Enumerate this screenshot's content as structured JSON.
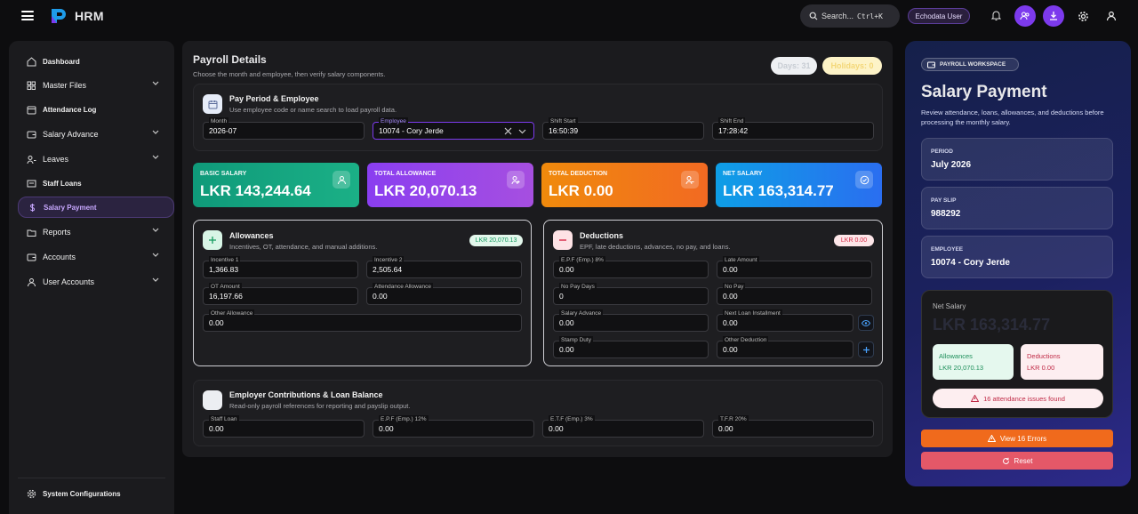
{
  "app": {
    "brand": "HRM",
    "search_label": "Search...",
    "search_shortcut": "Ctrl+K",
    "user": "Echodata User"
  },
  "sidebar": {
    "items": [
      {
        "label": "Dashboard",
        "icon": "home-icon",
        "chevron": false
      },
      {
        "label": "Master Files",
        "icon": "grid-icon",
        "chevron": true
      },
      {
        "label": "Attendance Log",
        "icon": "calendar-icon",
        "chevron": false
      },
      {
        "label": "Salary Advance",
        "icon": "wallet-icon",
        "chevron": true
      },
      {
        "label": "Leaves",
        "icon": "users-icon",
        "chevron": true
      },
      {
        "label": "Staff Loans",
        "icon": "loan-icon",
        "chevron": false
      },
      {
        "label": "Salary Payment",
        "icon": "dollar-icon",
        "chevron": false,
        "active": true
      },
      {
        "label": "Reports",
        "icon": "folder-icon",
        "chevron": true
      },
      {
        "label": "Accounts",
        "icon": "wallet-icon",
        "chevron": true
      },
      {
        "label": "User Accounts",
        "icon": "user-icon",
        "chevron": true
      }
    ],
    "footer": "System Configurations"
  },
  "page": {
    "title": "Payroll Details",
    "subtitle": "Choose the month and employee, then verify salary components.",
    "days": "Days: 31",
    "holidays": "Holidays: 0"
  },
  "period": {
    "title": "Pay Period & Employee",
    "subtitle": "Use employee code or name search to load payroll data.",
    "fields": {
      "month": {
        "label": "Month",
        "value": "2026-07"
      },
      "employee": {
        "label": "Employee",
        "value": "10074 - Cory Jerde"
      },
      "shift_start": {
        "label": "Shift Start",
        "value": "16:50:39"
      },
      "shift_end": {
        "label": "Shift End",
        "value": "17:28:42"
      }
    }
  },
  "stats": [
    {
      "label": "BASIC SALARY",
      "value": "LKR 143,244.64",
      "color": "#14a37f"
    },
    {
      "label": "TOTAL ALLOWANCE",
      "value": "LKR 20,070.13",
      "color": "#8b3fe8"
    },
    {
      "label": "TOTAL DEDUCTION",
      "value": "LKR 0.00",
      "color": "#f07d14"
    },
    {
      "label": "NET SALARY",
      "value": "LKR 163,314.77",
      "color": "#1d8ef0"
    }
  ],
  "allowances": {
    "title": "Allowances",
    "subtitle": "Incentives, OT, attendance, and manual additions.",
    "badge": "LKR 20,070.13",
    "fields": [
      {
        "label": "Incentive 1",
        "value": "1,366.83"
      },
      {
        "label": "Incentive 2",
        "value": "2,505.64"
      },
      {
        "label": "OT Amount",
        "value": "16,197.66"
      },
      {
        "label": "Attendance Allowance",
        "value": "0.00"
      },
      {
        "label": "Other Allowance",
        "value": "0.00"
      }
    ]
  },
  "deductions": {
    "title": "Deductions",
    "subtitle": "EPF, late deductions, advances, no pay, and loans.",
    "badge": "LKR 0.00",
    "fields": [
      {
        "label": "E.P.F (Emp.) 8%",
        "value": "0.00"
      },
      {
        "label": "Late Amount",
        "value": "0.00"
      },
      {
        "label": "No Pay Days",
        "value": "0"
      },
      {
        "label": "No Pay",
        "value": "0.00"
      },
      {
        "label": "Salary Advance",
        "value": "0.00"
      },
      {
        "label": "Next Loan Installment",
        "value": "0.00"
      },
      {
        "label": "Stamp Duty",
        "value": "0.00"
      },
      {
        "label": "Other Deduction",
        "value": "0.00"
      }
    ]
  },
  "employer": {
    "title": "Employer Contributions & Loan Balance",
    "subtitle": "Read-only payroll references for reporting and payslip output.",
    "fields": [
      {
        "label": "Staff Loan",
        "value": "0.00"
      },
      {
        "label": "E.P.F (Emp.) 12%",
        "value": "0.00"
      },
      {
        "label": "E.T.F (Emp.) 3%",
        "value": "0.00"
      },
      {
        "label": "T.F.R 20%",
        "value": "0.00"
      }
    ]
  },
  "right": {
    "tag": "PAYROLL WORKSPACE",
    "title": "Salary Payment",
    "subtitle": "Review attendance, loans, allowances, and deductions before processing the monthly salary.",
    "period_label": "PERIOD",
    "period": "July 2026",
    "payslip_label": "PAY SLIP",
    "payslip": "988292",
    "employee_label": "EMPLOYEE",
    "employee": "10074 - Cory Jerde",
    "net_label": "Net Salary",
    "net_value": "LKR 163,314.77",
    "allow_label": "Allowances",
    "allow_value": "LKR 20,070.13",
    "ded_label": "Deductions",
    "ded_value": "LKR 0.00",
    "issues": "16 attendance issues found",
    "errors_btn": "View 16 Errors",
    "reset_btn": "Reset"
  }
}
